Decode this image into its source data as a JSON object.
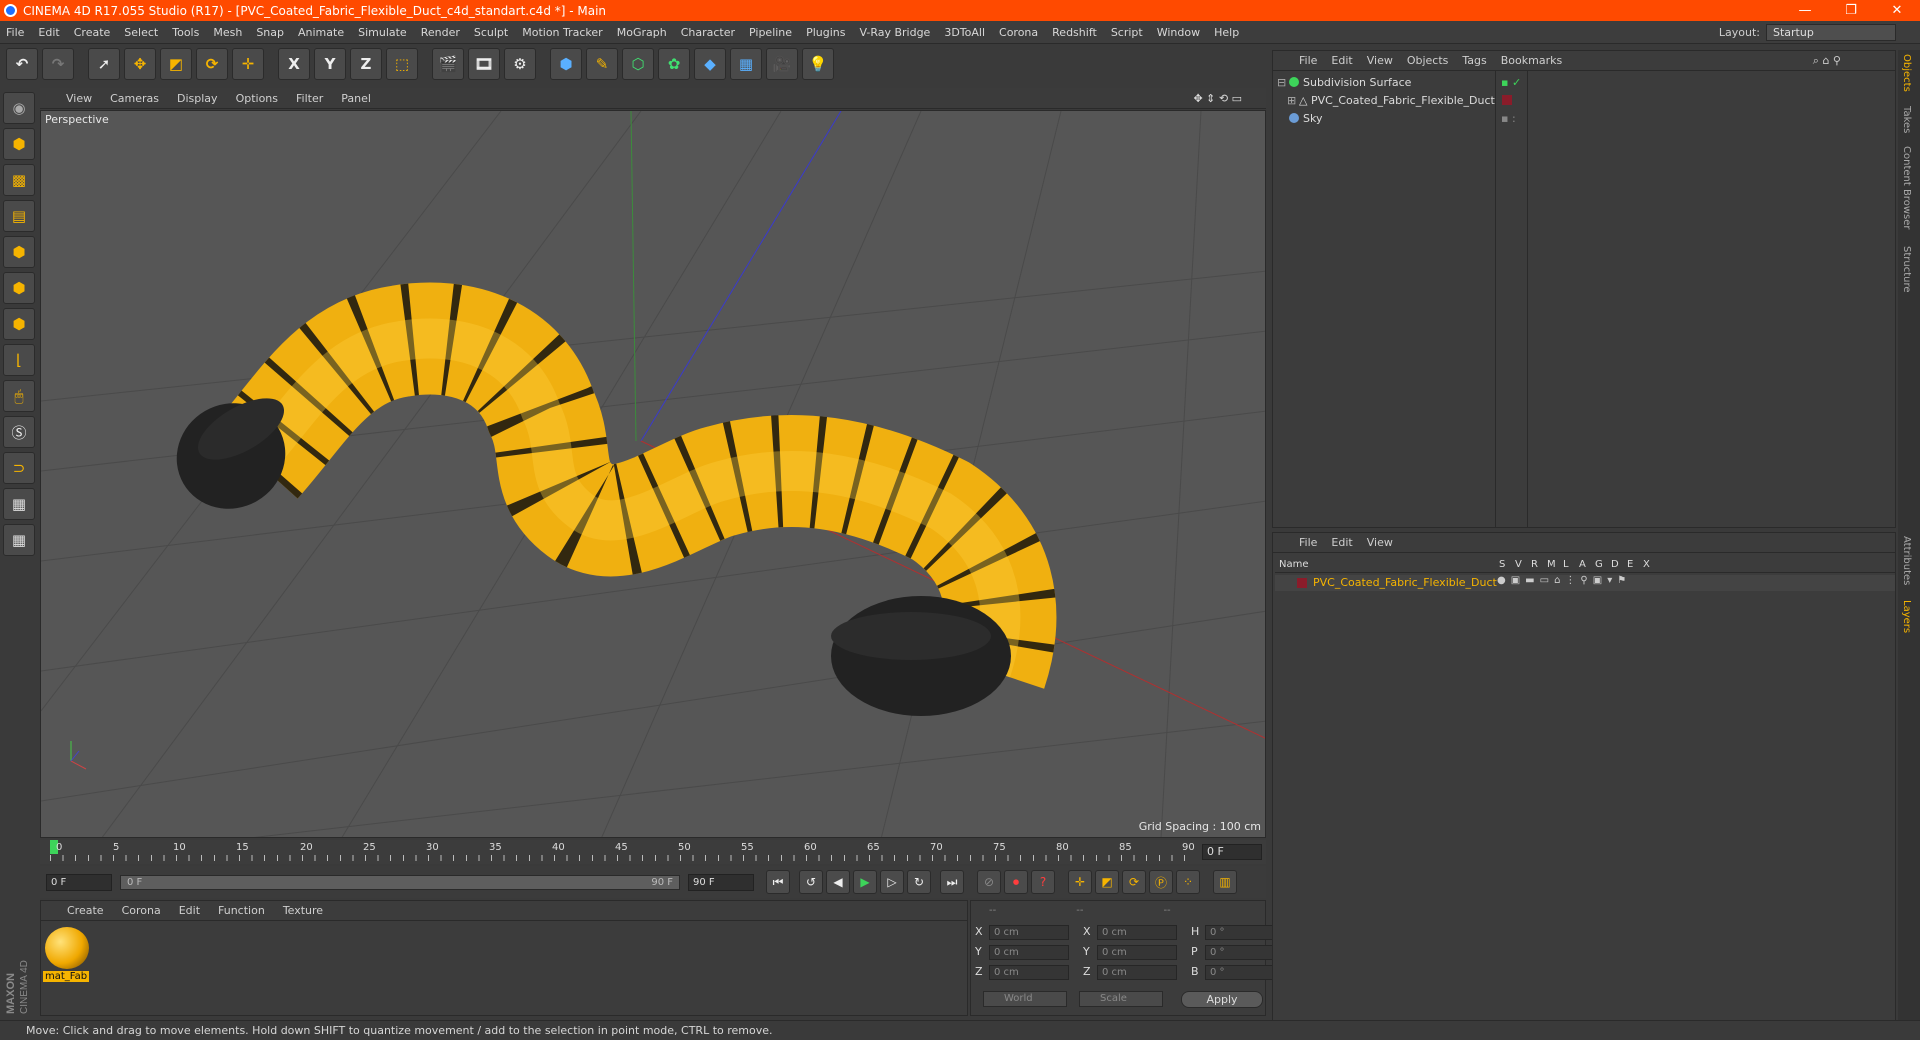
{
  "window": {
    "title": "CINEMA 4D R17.055 Studio (R17) - [PVC_Coated_Fabric_Flexible_Duct_c4d_standart.c4d *] - Main",
    "controls": [
      "—",
      "❐",
      "✕"
    ]
  },
  "menubar": [
    "File",
    "Edit",
    "Create",
    "Select",
    "Tools",
    "Mesh",
    "Snap",
    "Animate",
    "Simulate",
    "Render",
    "Sculpt",
    "Motion Tracker",
    "MoGraph",
    "Character",
    "Pipeline",
    "Plugins",
    "V-Ray Bridge",
    "3DToAll",
    "Corona",
    "Redshift",
    "Script",
    "Window",
    "Help"
  ],
  "layout": {
    "label": "Layout:",
    "value": "Startup"
  },
  "toolbar": {
    "axis_x": "X",
    "axis_y": "Y",
    "axis_z": "Z"
  },
  "viewport": {
    "menu": [
      "View",
      "Cameras",
      "Display",
      "Options",
      "Filter",
      "Panel"
    ],
    "label": "Perspective",
    "grid_spacing": "Grid Spacing : 100 cm"
  },
  "timeline": {
    "ticks": [
      "0",
      "5",
      "10",
      "15",
      "20",
      "25",
      "30",
      "35",
      "40",
      "45",
      "50",
      "55",
      "60",
      "65",
      "70",
      "75",
      "80",
      "85",
      "90"
    ],
    "current_frame": "0 F",
    "start": "0 F",
    "slider_start": "0 F",
    "slider_end": "90 F",
    "end": "90 F"
  },
  "material_manager": {
    "menu": [
      "Create",
      "Corona",
      "Edit",
      "Function",
      "Texture"
    ],
    "material_name": "mat_Fab"
  },
  "coordinates": {
    "headers": [
      "--",
      "--",
      "--"
    ],
    "rows": [
      {
        "l1": "X",
        "v1": "0 cm",
        "l2": "X",
        "v2": "0 cm",
        "l3": "H",
        "v3": "0 °"
      },
      {
        "l1": "Y",
        "v1": "0 cm",
        "l2": "Y",
        "v2": "0 cm",
        "l3": "P",
        "v3": "0 °"
      },
      {
        "l1": "Z",
        "v1": "0 cm",
        "l2": "Z",
        "v2": "0 cm",
        "l3": "B",
        "v3": "0 °"
      }
    ],
    "space": "World",
    "mode": "Scale",
    "apply": "Apply"
  },
  "object_manager": {
    "menu": [
      "File",
      "Edit",
      "View",
      "Objects",
      "Tags",
      "Bookmarks"
    ],
    "objects": [
      "Subdivision Surface",
      "PVC_Coated_Fabric_Flexible_Duct",
      "Sky"
    ]
  },
  "layer_manager": {
    "menu": [
      "File",
      "Edit",
      "View"
    ],
    "columns": [
      "Name",
      "S",
      "V",
      "R",
      "M",
      "L",
      "A",
      "G",
      "D",
      "E",
      "X"
    ],
    "layer_name": "PVC_Coated_Fabric_Flexible_Duct"
  },
  "side_tabs": [
    "Objects",
    "Takes",
    "Content Browser",
    "Structure",
    "Attributes",
    "Layers"
  ],
  "brand": {
    "maxon": "MAXON",
    "product": "CINEMA 4D"
  },
  "status": "Move: Click and drag to move elements. Hold down SHIFT to quantize movement / add to the selection in point mode, CTRL to remove.",
  "colors": {
    "accent": "#ff4a00",
    "duct_yellow": "#f6b400",
    "viewport_bg": "#565656"
  }
}
